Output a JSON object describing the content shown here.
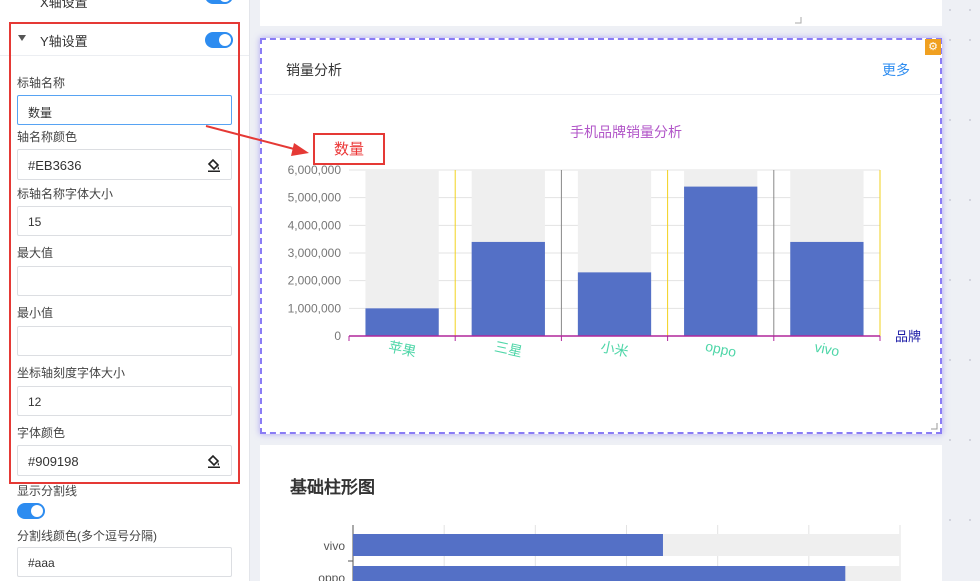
{
  "panel": {
    "prev_section_label": "X轴设置",
    "section_title": "Y轴设置",
    "fields": {
      "axis_name_label": "标轴名称",
      "axis_name_value": "数量",
      "axis_name_color_label": "轴名称颜色",
      "axis_name_color_value": "#EB3636",
      "axis_name_font_label": "标轴名称字体大小",
      "axis_name_font_value": "15",
      "max_label": "最大值",
      "max_value": "",
      "min_label": "最小值",
      "min_value": "",
      "tick_font_label": "坐标轴刻度字体大小",
      "tick_font_value": "12",
      "font_color_label": "字体颜色",
      "font_color_value": "#909198",
      "split_line_label": "显示分割线",
      "split_color_label": "分割线颜色(多个逗号分隔)",
      "split_color_value": "#aaa"
    }
  },
  "main_card": {
    "title": "销量分析",
    "more": "更多"
  },
  "bottom_card": {
    "title": "基础柱形图",
    "visible_categories": [
      "vivo",
      "oppo"
    ]
  },
  "colors": {
    "accent": "#2d8cf0",
    "bar": "#5470c6",
    "highlight": "#e53935",
    "chart_title": "#b155c8",
    "x_tick": "#4fd6a8",
    "x_axis": "#b0279c",
    "x_name": "#1a1aa6",
    "bar_bg": "#efefef"
  },
  "chart_data": [
    {
      "type": "bar",
      "title": "手机品牌销量分析",
      "xlabel": "品牌",
      "ylabel": "数量",
      "categories": [
        "苹果",
        "三星",
        "小米",
        "oppo",
        "vivo"
      ],
      "values": [
        1000000,
        3400000,
        2300000,
        5400000,
        3400000
      ],
      "ylim": [
        0,
        6000000
      ],
      "y_ticks": [
        "0",
        "1,000,000",
        "2,000,000",
        "3,000,000",
        "4,000,000",
        "5,000,000",
        "6,000,000"
      ],
      "grid": true,
      "show_background": true
    },
    {
      "type": "bar",
      "orientation": "horizontal",
      "categories": [
        "vivo",
        "oppo"
      ],
      "values": [
        3400000,
        5400000
      ],
      "xlim": [
        0,
        6000000
      ],
      "show_background": true
    }
  ]
}
